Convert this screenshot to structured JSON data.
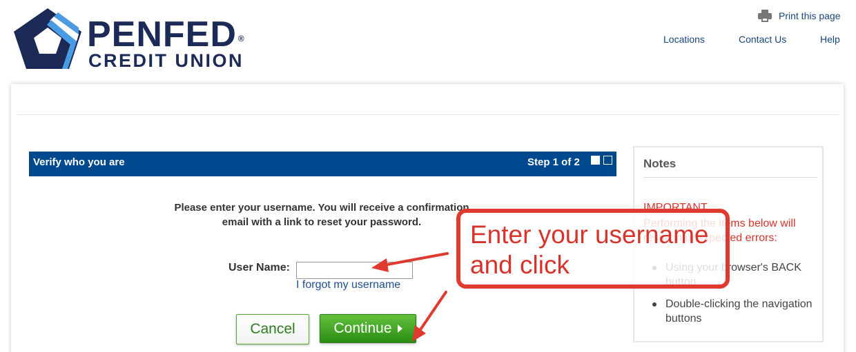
{
  "header": {
    "logo_line1": "PENFED",
    "logo_reg": "®",
    "logo_line2": "CREDIT UNION",
    "print_label": "Print this page",
    "nav": [
      "Locations",
      "Contact Us",
      "Help"
    ]
  },
  "step": {
    "title": "Verify who you are",
    "progress": "Step 1 of 2",
    "current": 1,
    "total": 2
  },
  "form": {
    "instructions_line1": "Please enter your username. You will receive a confirmation",
    "instructions_line2": "email with a link to reset your password.",
    "username_label": "User Name:",
    "username_value": "",
    "forgot_link": "I forgot my username",
    "cancel_label": "Cancel",
    "continue_label": "Continue"
  },
  "notes": {
    "title": "Notes",
    "important": "IMPORTANT",
    "warning": "Performing the items below will result in unexpected errors:",
    "items": [
      "Using your browser's BACK button",
      "Double-clicking the navigation buttons"
    ]
  },
  "annotation": {
    "line1": "Enter your username",
    "line2": "and click"
  },
  "colors": {
    "brand_navy": "#1b2a57",
    "step_bar": "#00498f",
    "link": "#16457e",
    "continue_green": "#2a8c13",
    "warning_red": "#d5352b",
    "annotation_red": "#e0392f"
  },
  "icons": {
    "logo": "penfed-logo-icon",
    "print": "printer-icon",
    "continue": "triangle-right-icon"
  }
}
